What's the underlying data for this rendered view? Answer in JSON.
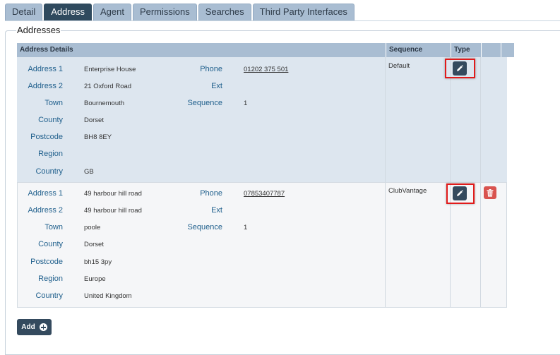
{
  "tabs": [
    {
      "label": "Detail",
      "active": false
    },
    {
      "label": "Address",
      "active": true
    },
    {
      "label": "Agent",
      "active": false
    },
    {
      "label": "Permissions",
      "active": false
    },
    {
      "label": "Searches",
      "active": false
    },
    {
      "label": "Third Party Interfaces",
      "active": false
    }
  ],
  "section": {
    "title": "Addresses"
  },
  "table": {
    "headers": {
      "details": "Address Details",
      "sequence": "Sequence",
      "type": "Type"
    },
    "labels": {
      "address1": "Address 1",
      "address2": "Address 2",
      "town": "Town",
      "county": "County",
      "postcode": "Postcode",
      "region": "Region",
      "country": "Country",
      "phone": "Phone",
      "ext": "Ext",
      "sequence": "Sequence"
    },
    "rows": [
      {
        "address1": "Enterprise House",
        "address2": "21 Oxford Road",
        "town": "Bournemouth",
        "county": "Dorset",
        "postcode": "BH8 8EY",
        "region": "",
        "country": "GB",
        "phone": "01202 375 501",
        "ext": "",
        "sequence": "1",
        "sequence_col": "Default",
        "has_delete": false
      },
      {
        "address1": "49 harbour hill road",
        "address2": "49 harbour hill road",
        "town": "poole",
        "county": "Dorset",
        "postcode": "bh15 3py",
        "region": "Europe",
        "country": "United Kingdom",
        "phone": "07853407787",
        "ext": "",
        "sequence": "1",
        "sequence_col": "ClubVantage",
        "has_delete": true
      }
    ]
  },
  "buttons": {
    "add_label": "Add"
  },
  "icons": {
    "edit": "pencil-icon",
    "delete": "trash-icon",
    "add": "plus-circle-icon"
  },
  "colors": {
    "header": "#a9bdd2",
    "active_tab": "#2f4a5e",
    "label": "#1f5f8c",
    "highlight": "#e11b1b",
    "delete": "#d9534f"
  }
}
